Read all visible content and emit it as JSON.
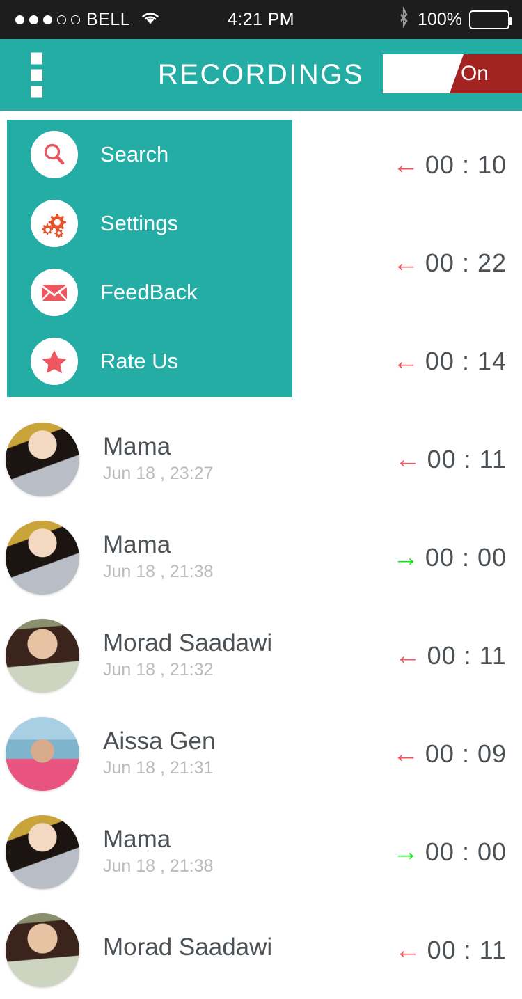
{
  "status_bar": {
    "signal_filled": 3,
    "signal_empty": 2,
    "carrier": "BELL",
    "wifi_icon": "wifi-icon",
    "time": "4:21 PM",
    "bluetooth_icon": "bluetooth-icon",
    "battery_percent": "100%",
    "battery_icon": "battery-full-icon"
  },
  "header": {
    "menu_icon": "overflow-menu-icon",
    "title": "RECORDINGS",
    "toggle": {
      "label": "On",
      "state": "on",
      "on_color": "#a32321"
    },
    "background_color": "#23ada4"
  },
  "menu": {
    "background_color": "#23ada4",
    "items": [
      {
        "label": "Search",
        "icon": "search-icon"
      },
      {
        "label": "Settings",
        "icon": "gear-icon"
      },
      {
        "label": "FeedBack",
        "icon": "envelope-icon"
      },
      {
        "label": "Rate Us",
        "icon": "star-icon"
      }
    ]
  },
  "colors": {
    "teal": "#23ada4",
    "incoming_arrow": "#f0565c",
    "outgoing_arrow": "#0ce812",
    "name_text": "#4c5155",
    "date_text": "#b9bcbe"
  },
  "recordings": [
    {
      "name": "",
      "date": "",
      "direction": "incoming",
      "arrow": "←",
      "duration": "00 : 10",
      "avatar": "hidden"
    },
    {
      "name": "",
      "date": "",
      "direction": "incoming",
      "arrow": "←",
      "duration": "00 : 22",
      "avatar": "hidden"
    },
    {
      "name": "",
      "date": "",
      "direction": "incoming",
      "arrow": "←",
      "duration": "00 : 14",
      "avatar": "hidden"
    },
    {
      "name": "Mama",
      "date": "Jun 18 , 23:27",
      "direction": "incoming",
      "arrow": "←",
      "duration": "00 : 11",
      "avatar": "woman-blonde"
    },
    {
      "name": "Mama",
      "date": "Jun 18 , 21:38",
      "direction": "outgoing",
      "arrow": "→",
      "duration": "00 : 00",
      "avatar": "woman-blonde"
    },
    {
      "name": "Morad Saadawi",
      "date": "Jun 18 , 21:32",
      "direction": "incoming",
      "arrow": "←",
      "duration": "00 : 11",
      "avatar": "man-beard"
    },
    {
      "name": "Aissa Gen",
      "date": "Jun 18 , 21:31",
      "direction": "incoming",
      "arrow": "←",
      "duration": "00 : 09",
      "avatar": "man-cap"
    },
    {
      "name": "Mama",
      "date": "Jun 18 , 21:38",
      "direction": "outgoing",
      "arrow": "→",
      "duration": "00 : 00",
      "avatar": "woman-blonde"
    },
    {
      "name": "Morad Saadawi",
      "date": "",
      "direction": "incoming",
      "arrow": "←",
      "duration": "00 : 11",
      "avatar": "man-beard"
    }
  ]
}
